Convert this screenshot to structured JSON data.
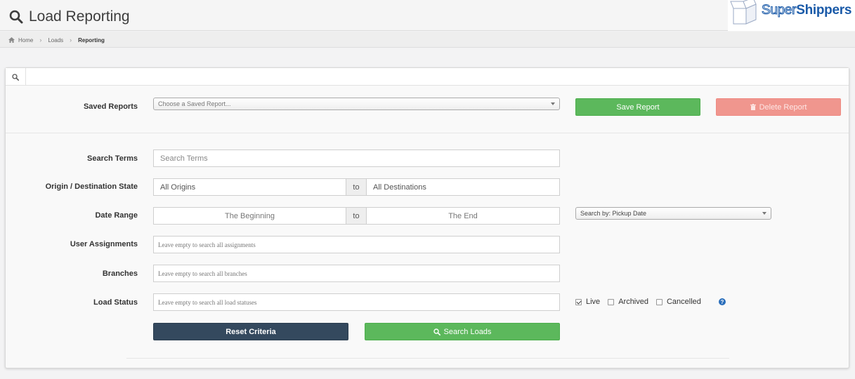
{
  "header": {
    "title": "Load Reporting",
    "logo_super": "Super",
    "logo_shippers": "Shippers"
  },
  "breadcrumb": {
    "home": "Home",
    "loads": "Loads",
    "current": "Reporting"
  },
  "saved_reports": {
    "label": "Saved Reports",
    "placeholder": "Choose a Saved Report...",
    "save_button": "Save Report",
    "delete_button": "Delete Report"
  },
  "form": {
    "search_terms": {
      "label": "Search Terms",
      "placeholder": "Search Terms"
    },
    "origin_destination": {
      "label": "Origin / Destination State",
      "origin_value": "All Origins",
      "to": "to",
      "destination_value": "All Destinations"
    },
    "date_range": {
      "label": "Date Range",
      "start_placeholder": "The Beginning",
      "to": "to",
      "end_placeholder": "The End",
      "search_by": "Search by: Pickup Date"
    },
    "user_assignments": {
      "label": "User Assignments",
      "placeholder": "Leave empty to search all assignments"
    },
    "branches": {
      "label": "Branches",
      "placeholder": "Leave empty to search all branches"
    },
    "load_status": {
      "label": "Load Status",
      "placeholder": "Leave empty to search all load statuses",
      "options": [
        {
          "label": "Live",
          "checked": true
        },
        {
          "label": "Archived",
          "checked": false
        },
        {
          "label": "Cancelled",
          "checked": false
        }
      ],
      "help": "?"
    }
  },
  "actions": {
    "reset": "Reset Criteria",
    "search": "Search Loads"
  },
  "colors": {
    "green": "#5cb85c",
    "red": "#f0968e",
    "navy": "#34495e",
    "brand_blue": "#1a5aa8"
  }
}
